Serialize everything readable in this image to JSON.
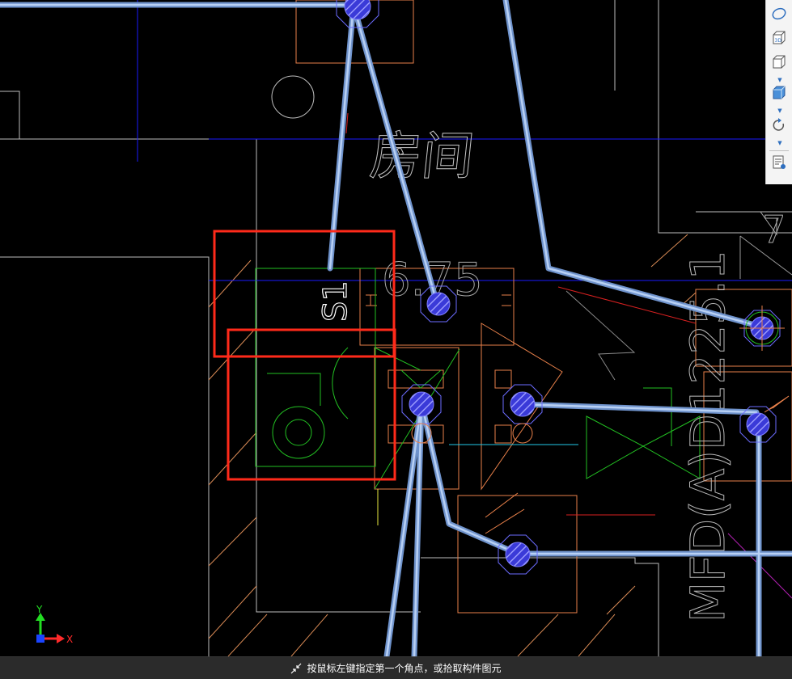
{
  "drawing": {
    "room_label": "房间",
    "elevation_label": "6.75",
    "rotated_code": "S1",
    "equipment_label": "MFD(A)D1225.1",
    "corner_number": "7"
  },
  "axis": {
    "x": "X",
    "y": "Y"
  },
  "toolbar": {
    "items": [
      {
        "icon": "orbit-icon"
      },
      {
        "icon": "3d-view-icon",
        "text": "3D"
      },
      {
        "icon": "wireframe-cube-icon"
      },
      {
        "icon": "shaded-cube-icon"
      },
      {
        "icon": "rotate-icon"
      },
      {
        "icon": "view-settings-icon"
      }
    ]
  },
  "status": {
    "prompt": "按鼠标左键指定第一个角点，或拾取构件图元"
  },
  "colors": {
    "background": "#000000",
    "pipe": "#8fb3e8",
    "selection": "#ff2a1a",
    "equipment_orange": "#e8804a",
    "valve_green": "#22c022",
    "gridline_blue": "#1a1aff",
    "wall_white": "#c8c8c8"
  }
}
